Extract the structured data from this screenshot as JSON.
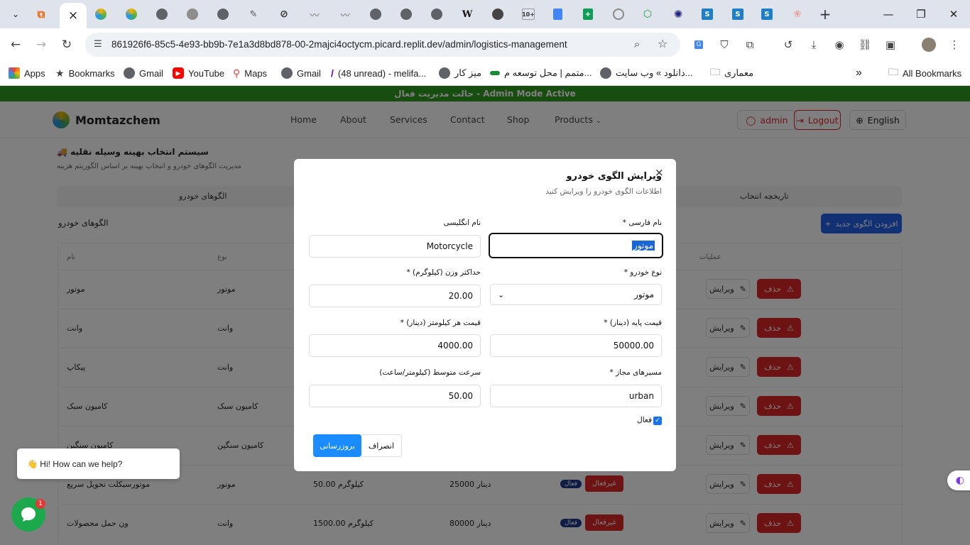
{
  "browser": {
    "tabs": [
      {
        "icon": "tab-list-icon"
      },
      {
        "icon": "replit-icon",
        "color": "#f26207"
      },
      {
        "icon": "momtazchem-icon",
        "active": true
      },
      {
        "icon": "momtazchem-icon"
      },
      {
        "icon": "momtazchem-icon"
      },
      {
        "icon": "globe-icon"
      },
      {
        "icon": "gear-logo-icon"
      },
      {
        "icon": "globe-icon"
      },
      {
        "icon": "drafting-icon"
      },
      {
        "icon": "slash-icon"
      },
      {
        "icon": "grey-logo-icon"
      },
      {
        "icon": "grey-logo-icon"
      },
      {
        "icon": "globe-icon"
      },
      {
        "icon": "globe-icon"
      },
      {
        "icon": "globe-icon"
      },
      {
        "icon": "wikipedia-icon"
      },
      {
        "icon": "whatsapp-icon"
      },
      {
        "icon": "gmail-icon"
      },
      {
        "icon": "docs-icon"
      },
      {
        "icon": "sheets-icon"
      },
      {
        "icon": "circle-icon"
      },
      {
        "icon": "green-shield-icon"
      },
      {
        "icon": "star-logo-icon"
      },
      {
        "icon": "s-icon"
      },
      {
        "icon": "s-icon"
      },
      {
        "icon": "s-icon"
      },
      {
        "icon": "flower-icon"
      }
    ],
    "new_tab": "+",
    "close_tab": "×",
    "url": "861926f6-85c5-4e93-bb9b-7e1a3d8bd878-00-2majci4octycm.picard.replit.dev/admin/logistics-management",
    "gmail_badge": "10+",
    "bookmarks": [
      {
        "label": "Apps",
        "icon": "apps-grid-icon"
      },
      {
        "label": "Bookmarks",
        "icon": "star-icon"
      },
      {
        "label": "Gmail",
        "icon": "globe-icon"
      },
      {
        "label": "YouTube",
        "icon": "youtube-icon"
      },
      {
        "label": "Maps",
        "icon": "maps-icon"
      },
      {
        "label": "Gmail",
        "icon": "globe-icon"
      },
      {
        "label": "(48 unread) - melifa...",
        "icon": "yahoo-icon"
      },
      {
        "label": "میز کار",
        "icon": "globe-icon"
      },
      {
        "label": "متمم | محل توسعه م...",
        "icon": "green-logo-icon"
      },
      {
        "label": "دانلود » وب سایت...",
        "icon": "globe-icon"
      },
      {
        "label": "معماری",
        "icon": "folder-icon"
      }
    ],
    "more_bookmarks": "»",
    "all_bookmarks": "All Bookmarks"
  },
  "site": {
    "banner": "حالت مدیریت فعال - Admin Mode Active",
    "logo": "Momtazchem",
    "nav": [
      "Home",
      "About",
      "Services",
      "Contact",
      "Shop",
      "Products"
    ],
    "admin_label": "admin",
    "logout_label": "Logout",
    "language_label": "English"
  },
  "logistics": {
    "title": "سیستم انتخاب بهینه وسیله نقلیه",
    "subtitle": "مدیریت الگوهای خودرو و انتخاب بهینه بر اساس الگوریتم هزینه",
    "tab_templates": "الگوهای خودرو",
    "tab_history": "تاریخچه انتخاب",
    "list_title": "الگوهای خودرو",
    "add_button": "افزودن الگوی جدید",
    "columns": {
      "name": "نام",
      "type": "نوع",
      "actions": "عملیات"
    },
    "rows": [
      {
        "name": "موتور",
        "type": "موتور",
        "capacity": "",
        "price": "",
        "status": "",
        "active": ""
      },
      {
        "name": "وانت",
        "type": "وانت",
        "capacity": "",
        "price": "",
        "status": "",
        "active": ""
      },
      {
        "name": "پیکاپ",
        "type": "وانت",
        "capacity": "",
        "price": "",
        "status": "",
        "active": ""
      },
      {
        "name": "کامیون سبک",
        "type": "کامیون سبک",
        "capacity": "",
        "price": "",
        "status": "",
        "active": ""
      },
      {
        "name": "کامیون سنگین",
        "type": "کامیون سنگین",
        "capacity": "",
        "price": "",
        "status": "",
        "active": ""
      },
      {
        "name": "موتورسیکلت تحویل سریع",
        "type": "موتور",
        "capacity": "50.00 کیلوگرم",
        "price": "25000 دینار",
        "status": "غیرفعال",
        "active": "فعال"
      },
      {
        "name": "ون حمل محصولات",
        "type": "وانت",
        "capacity": "1500.00 کیلوگرم",
        "price": "80000 دینار",
        "status": "غیرفعال",
        "active": "فعال"
      }
    ],
    "edit_label": "ویرایش",
    "delete_label": "حذف"
  },
  "modal": {
    "title": "ویرایش الگوی خودرو",
    "description": "اطلاعات الگوی خودرو را ویرایش کنید",
    "fields": {
      "name_fa_label": "نام فارسی *",
      "name_fa_value": "موتور",
      "name_en_label": "نام انگلیسی",
      "name_en_value": "Motorcycle",
      "vehicle_type_label": "نوع خودرو *",
      "vehicle_type_value": "موتور",
      "max_weight_label": "حداکثر وزن (کیلوگرم) *",
      "max_weight_value": "20.00",
      "base_price_label": "قیمت پایه (دینار) *",
      "base_price_value": "50000.00",
      "price_per_km_label": "قیمت هر کیلومتر (دینار) *",
      "price_per_km_value": "4000.00",
      "routes_label": "مسیرهای مجاز *",
      "routes_value": "urban",
      "avg_speed_label": "سرعت متوسط (کیلومتر/ساعت)",
      "avg_speed_value": "50.00",
      "active_label": "فعال",
      "active_checked": true
    },
    "save_label": "بروزرسانی",
    "cancel_label": "انصراف",
    "close": "×"
  },
  "chat": {
    "greeting": "👋 Hi! How can we help?",
    "badge": "1"
  }
}
